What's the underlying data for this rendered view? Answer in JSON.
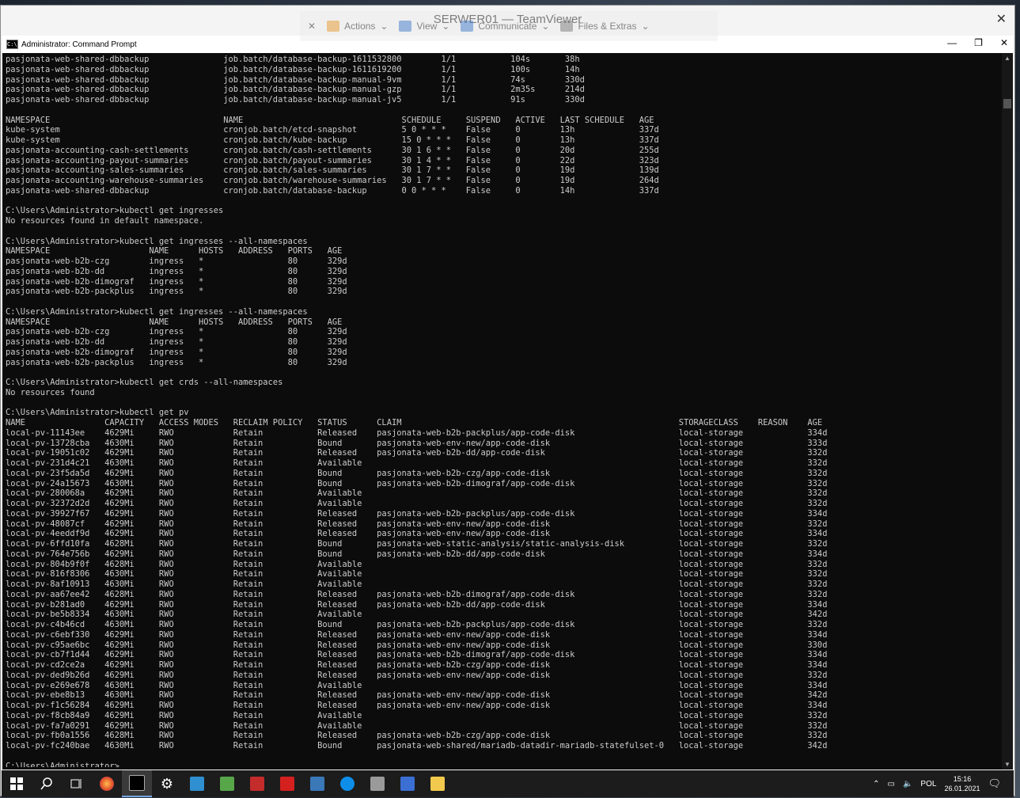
{
  "window": {
    "title": "SERWER01 — TeamViewer",
    "close": "✕"
  },
  "cmd": {
    "title": "Administrator: Command Prompt",
    "min": "—",
    "max": "❐",
    "close": "✕"
  },
  "teamviewer_toolbar": [
    "Actions",
    "View",
    "Communicate",
    "Files & Extras"
  ],
  "console_lines": [
    "pasjonata-web-shared-dbbackup               job.batch/database-backup-1611532800        1/1           104s       38h",
    "pasjonata-web-shared-dbbackup               job.batch/database-backup-1611619200        1/1           100s       14h",
    "pasjonata-web-shared-dbbackup               job.batch/database-backup-manual-9vm        1/1           74s        330d",
    "pasjonata-web-shared-dbbackup               job.batch/database-backup-manual-gzp        1/1           2m35s      214d",
    "pasjonata-web-shared-dbbackup               job.batch/database-backup-manual-jv5        1/1           91s        330d",
    "",
    "NAMESPACE                                   NAME                                SCHEDULE     SUSPEND   ACTIVE   LAST SCHEDULE   AGE",
    "kube-system                                 cronjob.batch/etcd-snapshot         5 0 * * *    False     0        13h             337d",
    "kube-system                                 cronjob.batch/kube-backup           15 0 * * *   False     0        13h             337d",
    "pasjonata-accounting-cash-settlements       cronjob.batch/cash-settlements      30 1 6 * *   False     0        20d             255d",
    "pasjonata-accounting-payout-summaries       cronjob.batch/payout-summaries      30 1 4 * *   False     0        22d             323d",
    "pasjonata-accounting-sales-summaries        cronjob.batch/sales-summaries       30 1 7 * *   False     0        19d             139d",
    "pasjonata-accounting-warehouse-summaries    cronjob.batch/warehouse-summaries   30 1 7 * *   False     0        19d             264d",
    "pasjonata-web-shared-dbbackup               cronjob.batch/database-backup       0 0 * * *    False     0        14h             337d",
    "",
    "C:\\Users\\Administrator>kubectl get ingresses",
    "No resources found in default namespace.",
    "",
    "C:\\Users\\Administrator>kubectl get ingresses --all-namespaces",
    "NAMESPACE                    NAME      HOSTS   ADDRESS   PORTS   AGE",
    "pasjonata-web-b2b-czg        ingress   *                 80      329d",
    "pasjonata-web-b2b-dd         ingress   *                 80      329d",
    "pasjonata-web-b2b-dimograf   ingress   *                 80      329d",
    "pasjonata-web-b2b-packplus   ingress   *                 80      329d",
    "",
    "C:\\Users\\Administrator>kubectl get ingresses --all-namespaces",
    "NAMESPACE                    NAME      HOSTS   ADDRESS   PORTS   AGE",
    "pasjonata-web-b2b-czg        ingress   *                 80      329d",
    "pasjonata-web-b2b-dd         ingress   *                 80      329d",
    "pasjonata-web-b2b-dimograf   ingress   *                 80      329d",
    "pasjonata-web-b2b-packplus   ingress   *                 80      329d",
    "",
    "C:\\Users\\Administrator>kubectl get crds --all-namespaces",
    "No resources found",
    "",
    "C:\\Users\\Administrator>kubectl get pv",
    "NAME                CAPACITY   ACCESS MODES   RECLAIM POLICY   STATUS      CLAIM                                                        STORAGECLASS    REASON    AGE",
    "local-pv-11143ee    4629Mi     RWO            Retain           Released    pasjonata-web-b2b-packplus/app-code-disk                     local-storage             334d",
    "local-pv-13728cba   4630Mi     RWO            Retain           Bound       pasjonata-web-env-new/app-code-disk                          local-storage             333d",
    "local-pv-19051c02   4629Mi     RWO            Retain           Released    pasjonata-web-b2b-dd/app-code-disk                           local-storage             332d",
    "local-pv-231d4c21   4630Mi     RWO            Retain           Available                                                                local-storage             332d",
    "local-pv-23f5da5d   4629Mi     RWO            Retain           Bound       pasjonata-web-b2b-czg/app-code-disk                          local-storage             332d",
    "local-pv-24a15673   4630Mi     RWO            Retain           Bound       pasjonata-web-b2b-dimograf/app-code-disk                     local-storage             332d",
    "local-pv-280068a    4629Mi     RWO            Retain           Available                                                                local-storage             332d",
    "local-pv-32372d2d   4629Mi     RWO            Retain           Available                                                                local-storage             332d",
    "local-pv-39927f67   4629Mi     RWO            Retain           Released    pasjonata-web-b2b-packplus/app-code-disk                     local-storage             334d",
    "local-pv-48087cf    4629Mi     RWO            Retain           Released    pasjonata-web-env-new/app-code-disk                          local-storage             332d",
    "local-pv-4eeddf9d   4629Mi     RWO            Retain           Released    pasjonata-web-env-new/app-code-disk                          local-storage             334d",
    "local-pv-6ffd10fa   4628Mi     RWO            Retain           Bound       pasjonata-web-static-analysis/static-analysis-disk           local-storage             332d",
    "local-pv-764e756b   4629Mi     RWO            Retain           Bound       pasjonata-web-b2b-dd/app-code-disk                           local-storage             334d",
    "local-pv-804b9f0f   4628Mi     RWO            Retain           Available                                                                local-storage             332d",
    "local-pv-816f8306   4630Mi     RWO            Retain           Available                                                                local-storage             332d",
    "local-pv-8af10913   4630Mi     RWO            Retain           Available                                                                local-storage             332d",
    "local-pv-aa67ee42   4628Mi     RWO            Retain           Released    pasjonata-web-b2b-dimograf/app-code-disk                     local-storage             332d",
    "local-pv-b281ad0    4629Mi     RWO            Retain           Released    pasjonata-web-b2b-dd/app-code-disk                           local-storage             334d",
    "local-pv-be5b8334   4630Mi     RWO            Retain           Available                                                                local-storage             342d",
    "local-pv-c4b46cd    4630Mi     RWO            Retain           Bound       pasjonata-web-b2b-packplus/app-code-disk                     local-storage             332d",
    "local-pv-c6ebf330   4629Mi     RWO            Retain           Released    pasjonata-web-env-new/app-code-disk                          local-storage             334d",
    "local-pv-c95ae6bc   4629Mi     RWO            Retain           Released    pasjonata-web-env-new/app-code-disk                          local-storage             330d",
    "local-pv-cb7f1d44   4629Mi     RWO            Retain           Released    pasjonata-web-b2b-dimograf/app-code-disk                     local-storage             334d",
    "local-pv-cd2ce2a    4629Mi     RWO            Retain           Released    pasjonata-web-b2b-czg/app-code-disk                          local-storage             334d",
    "local-pv-ded9b26d   4629Mi     RWO            Retain           Released    pasjonata-web-env-new/app-code-disk                          local-storage             332d",
    "local-pv-e269e678   4630Mi     RWO            Retain           Available                                                                local-storage             334d",
    "local-pv-ebe8b13    4630Mi     RWO            Retain           Released    pasjonata-web-env-new/app-code-disk                          local-storage             342d",
    "local-pv-f1c56284   4629Mi     RWO            Retain           Released    pasjonata-web-env-new/app-code-disk                          local-storage             334d",
    "local-pv-f8cb84a9   4629Mi     RWO            Retain           Available                                                                local-storage             332d",
    "local-pv-fa7a0291   4629Mi     RWO            Retain           Available                                                                local-storage             332d",
    "local-pv-fb0a1556   4628Mi     RWO            Retain           Released    pasjonata-web-b2b-czg/app-code-disk                          local-storage             332d",
    "local-pv-fc240bae   4630Mi     RWO            Retain           Bound       pasjonata-web-shared/mariadb-datadir-mariadb-statefulset-0   local-storage             342d",
    "",
    "C:\\Users\\Administrator>"
  ],
  "taskbar": {
    "apps": [
      "start-icon",
      "search-icon",
      "task-view-icon",
      "firefox-icon",
      "cmd-icon",
      "settings-icon",
      "app-icon-1",
      "app-icon-2",
      "app-icon-3",
      "acrobat-icon",
      "app-icon-4",
      "teamviewer-icon",
      "app-icon-5",
      "network-app-icon",
      "folder-icon"
    ],
    "lang": "POL",
    "time": "15:16",
    "date": "26.01.2021"
  },
  "colors": {
    "console_bg": "#0c0c0c",
    "console_fg": "#cccccc",
    "taskbar_bg": "#1c1c1c"
  }
}
